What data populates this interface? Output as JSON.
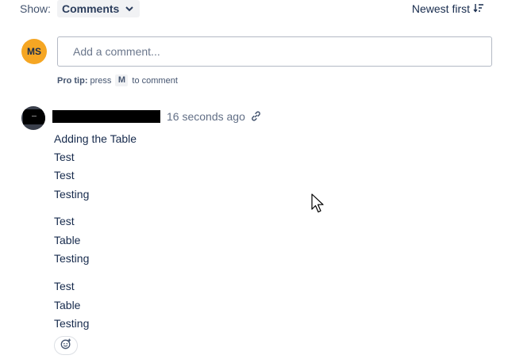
{
  "toolbar": {
    "show_label": "Show:",
    "filter_value": "Comments",
    "sort_label": "Newest first"
  },
  "composer": {
    "avatar_initials": "MS",
    "placeholder": "Add a comment...",
    "protip_bold": "Pro tip:",
    "protip_press": "press",
    "protip_key": "M",
    "protip_suffix": "to comment"
  },
  "comment": {
    "timestamp": "16 seconds ago",
    "lines": [
      "Adding the Table",
      "Test",
      "Test",
      "Testing",
      "Test",
      "Table",
      "Testing",
      "Test",
      "Table",
      "Testing"
    ]
  },
  "icons": {
    "filter_chevron": "chevron-down-icon",
    "sort": "sort-descending-icon",
    "permalink": "link-icon",
    "reaction": "emoji-add-icon"
  },
  "colors": {
    "avatar_ms": "#f5a623",
    "text_primary": "#172b4d",
    "text_subtle": "#626f86"
  }
}
